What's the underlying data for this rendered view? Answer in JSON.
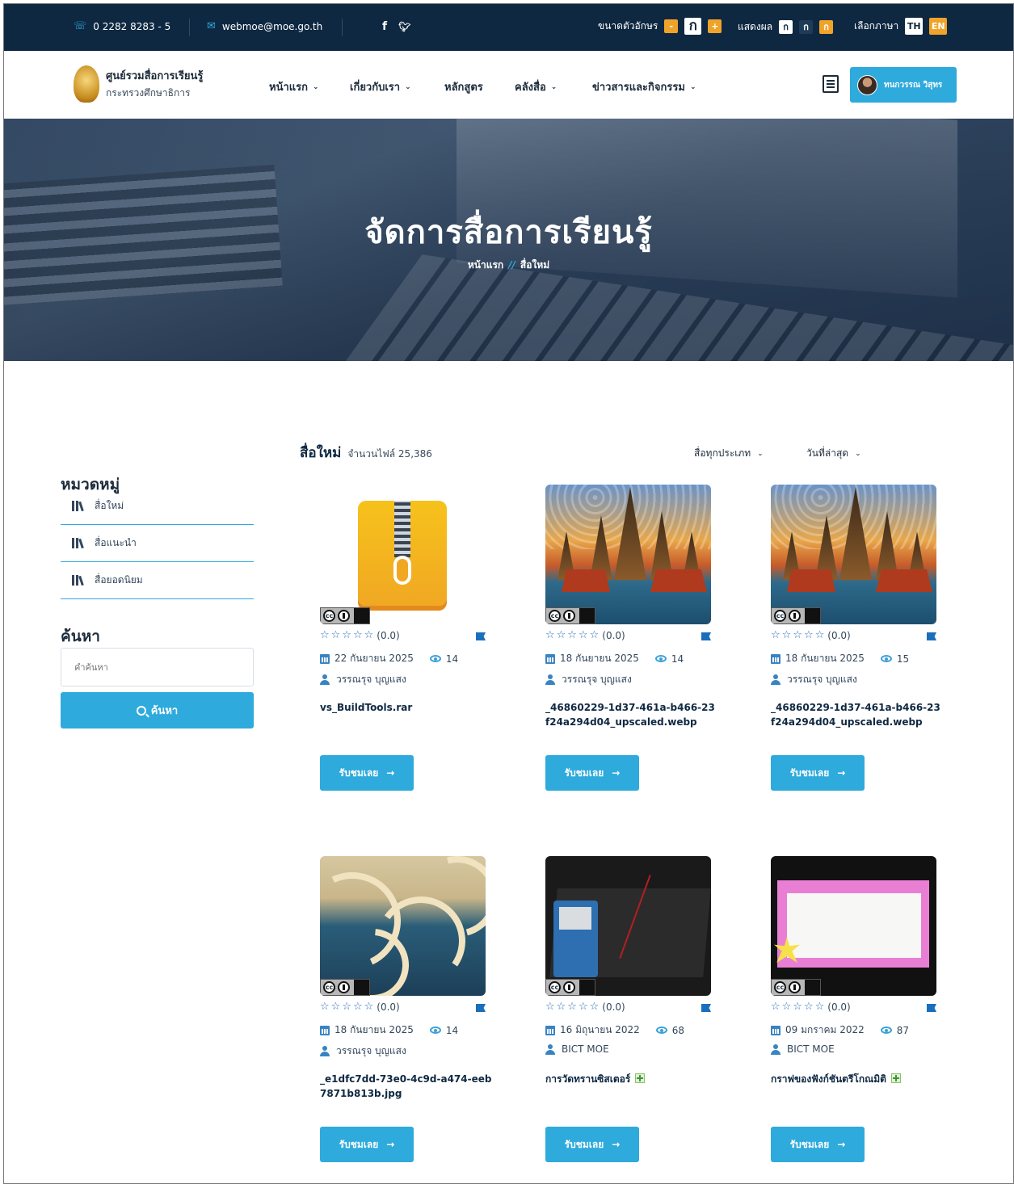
{
  "topbar": {
    "phone": "0 2282 8283 - 5",
    "email": "webmoe@moe.go.th",
    "social": [
      "f",
      "twitter"
    ],
    "font_size_label": "ขนาดตัวอักษร",
    "font_size_buttons": [
      "-",
      "ก",
      "+"
    ],
    "display_label": "แสดงผล",
    "display_buttons": [
      "ก",
      "ก",
      "ก"
    ],
    "language_label": "เลือกภาษา",
    "languages": [
      "TH",
      "EN"
    ]
  },
  "brand": {
    "line1": "ศูนย์รวมสื่อการเรียนรู้",
    "line2": "กระทรวงศึกษาธิการ"
  },
  "nav": {
    "items": [
      {
        "label": "หน้าแรก",
        "dropdown": true
      },
      {
        "label": "เกี่ยวกับเรา",
        "dropdown": true
      },
      {
        "label": "หลักสูตร",
        "dropdown": false
      },
      {
        "label": "คลังสื่อ",
        "dropdown": true
      },
      {
        "label": "ข่าวสารและกิจกรรม",
        "dropdown": true
      }
    ],
    "user_name": "ทนกวรรณ วิสุทร"
  },
  "hero": {
    "title": "จัดการสื่อการเรียนรู้",
    "breadcrumb_home": "หน้าแรก",
    "breadcrumb_sep": "//",
    "breadcrumb_current": "สื่อใหม่"
  },
  "sidebar": {
    "category_title": "หมวดหมู่",
    "categories": [
      "สื่อใหม่",
      "สื่อแนะนำ",
      "สื่อยอดนิยม"
    ],
    "search_title": "ค้นหา",
    "search_placeholder": "คำค้นหา",
    "search_button": "ค้นหา"
  },
  "listing": {
    "title": "สื่อใหม่",
    "count_text": "จำนวนไฟล์ 25,386",
    "filter_type": "สื่อทุกประเภท",
    "filter_sort": "วันที่ล่าสุด",
    "view_label": "รับชมเลย",
    "arrow": "→",
    "cards": [
      {
        "rating": "(0.0)",
        "date": "22 กันยายน 2025",
        "views": "14",
        "author": "วรรณรุจ บุญแสง",
        "filename": "vs_BuildTools.rar",
        "thumb": "zip"
      },
      {
        "rating": "(0.0)",
        "date": "18 กันยายน 2025",
        "views": "14",
        "author": "วรรณรุจ บุญแสง",
        "filename": "_46860229-1d37-461a-b466-23f24a294d04_upscaled.webp",
        "thumb": "temple"
      },
      {
        "rating": "(0.0)",
        "date": "18 กันยายน 2025",
        "views": "15",
        "author": "วรรณรุจ บุญแสง",
        "filename": "_46860229-1d37-461a-b466-23f24a294d04_upscaled.webp",
        "thumb": "temple"
      },
      {
        "rating": "(0.0)",
        "date": "18 กันยายน 2025",
        "views": "14",
        "author": "วรรณรุจ บุญแสง",
        "filename": "_e1dfc7dd-73e0-4c9d-a474-eeb7871b813b.jpg",
        "thumb": "wave"
      },
      {
        "rating": "(0.0)",
        "date": "16 มิถุนายน 2022",
        "views": "68",
        "author": "BICT MOE",
        "filename": "การวัดทรานซิสเตอร์",
        "thumb": "video"
      },
      {
        "rating": "(0.0)",
        "date": "09 มกราคม 2022",
        "views": "87",
        "author": "BICT MOE",
        "filename": "กราฟของฟังก์ชันตรีโกณมิติ",
        "thumb": "slide"
      }
    ]
  },
  "colors": {
    "primary": "#2eaadc",
    "dark": "#0f2842",
    "accent": "#f0a329",
    "star": "#2e6fb8"
  }
}
